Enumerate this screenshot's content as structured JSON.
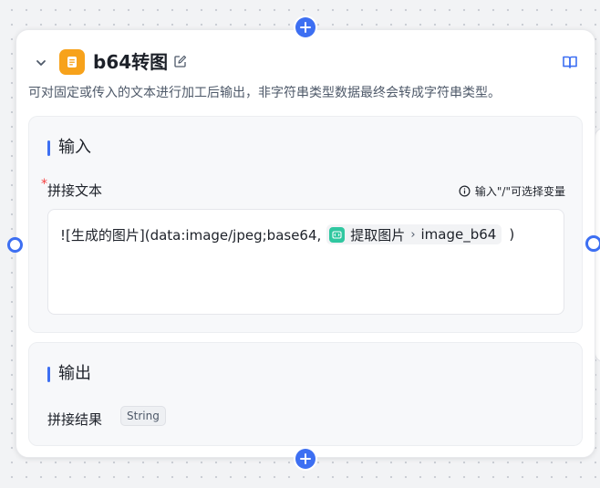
{
  "node": {
    "title": "b64转图",
    "description": "可对固定或传入的文本进行加工后输出，非字符串类型数据最终会转成字符串类型。",
    "icon": "document-icon"
  },
  "input_section": {
    "title": "输入",
    "field_label": "拼接文本",
    "required_mark": "*",
    "hint": "输入\"/\"可选择变量",
    "editor": {
      "prefix_text": "![生成的图片](data:image/jpeg;base64,",
      "variable": {
        "source": "提取图片",
        "field": "image_b64"
      },
      "suffix_text": ")"
    }
  },
  "output_section": {
    "title": "输出",
    "field_label": "拼接结果",
    "type": "String"
  },
  "colors": {
    "accent": "#3d6ff2",
    "icon_bg": "#f7a21b",
    "variable_icon_bg": "#2fc7a0",
    "required": "#f53f3f"
  }
}
